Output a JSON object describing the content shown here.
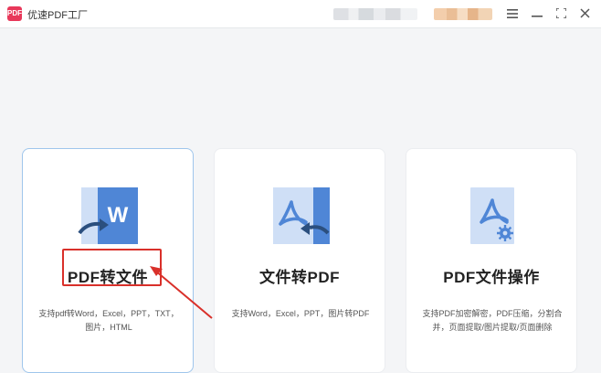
{
  "window": {
    "title": "优速PDF工厂",
    "logo_text": "PDF",
    "controls": {
      "menu_icon": "hamburger-menu-icon",
      "minimize_icon": "minimize-icon",
      "maximize_icon": "maximize-icon",
      "close_icon": "close-icon"
    }
  },
  "cards": [
    {
      "title": "PDF转文件",
      "description": "支持pdf转Word，Excel，PPT，TXT，图片，HTML",
      "icon": "pdf-to-word-icon",
      "selected": true
    },
    {
      "title": "文件转PDF",
      "description": "支持Word，Excel，PPT，图片转PDF",
      "icon": "file-to-pdf-icon",
      "selected": false
    },
    {
      "title": "PDF文件操作",
      "description": "支持PDF加密解密，PDF压缩，分割合并，页面提取/图片提取/页面删除",
      "icon": "pdf-operations-icon",
      "selected": false
    }
  ],
  "colors": {
    "accent_blue": "#4f86d6",
    "light_blue": "#cfdff6",
    "highlight_red": "#d9302a",
    "brand_pink": "#e8385a"
  }
}
